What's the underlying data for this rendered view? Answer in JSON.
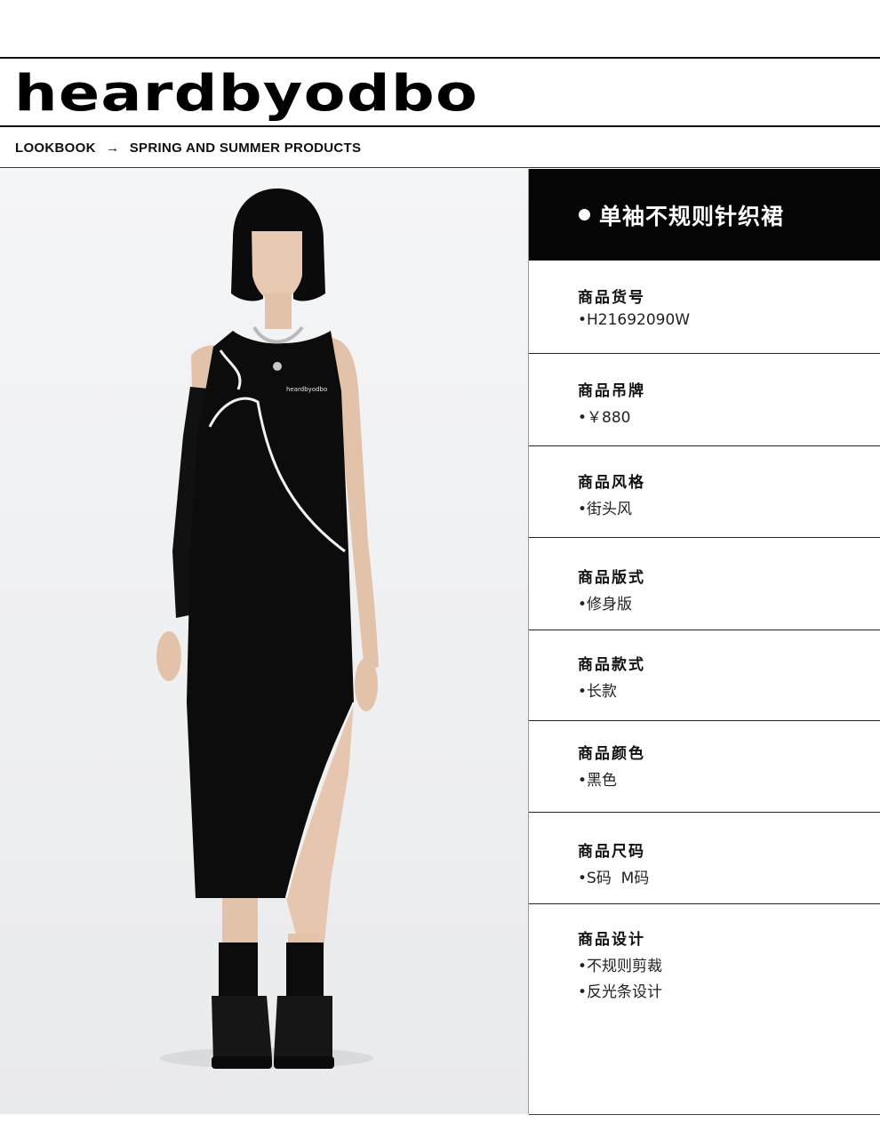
{
  "brand": {
    "logo_text": "heardbyodbo"
  },
  "breadcrumb": {
    "items": [
      "LOOKBOOK",
      "SPRING AND SUMMER PRODUCTS"
    ],
    "separator": "→"
  },
  "product": {
    "title": "单袖不规则针织裙",
    "attributes": [
      {
        "label": "商品货号",
        "values": [
          "H21692090W"
        ]
      },
      {
        "label": "商品吊牌",
        "values": [
          "￥880"
        ]
      },
      {
        "label": "商品风格",
        "values": [
          "街头风"
        ]
      },
      {
        "label": "商品版式",
        "values": [
          "修身版"
        ]
      },
      {
        "label": "商品款式",
        "values": [
          "长款"
        ]
      },
      {
        "label": "商品颜色",
        "values": [
          "黑色"
        ]
      },
      {
        "label": "商品尺码",
        "values": [
          "S码  M码"
        ]
      },
      {
        "label": "商品设计",
        "values": [
          "不规则剪裁",
          "反光条设计"
        ]
      }
    ],
    "chest_print": "heardbyodbo"
  },
  "icons": {
    "bullet": "•",
    "title_dot": "dot-icon",
    "arrow": "arrow-right-icon"
  },
  "colors": {
    "ink": "#111111",
    "header_bg": "#050505",
    "header_text": "#ffffff",
    "photo_bg": "#f0f1f3"
  }
}
